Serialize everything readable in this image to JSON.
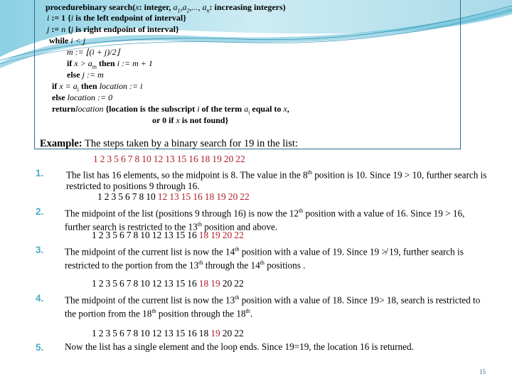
{
  "procedure": {
    "lines": [
      {
        "kw": "procedure",
        "rest": "binary search(",
        "x": "x",
        "rest2": ": integer, ",
        "a": "a",
        "subs": [
          "1",
          "2",
          "n"
        ],
        "rest3": ": increasing integers)"
      },
      {
        "text_a": "i",
        "text_b": " := 1 {",
        "text_c": "i",
        "text_d": " is the left endpoint of interval}"
      },
      {
        "text_a": "j",
        "text_b": " := ",
        "text_c": "n",
        "text_d": " {",
        "text_e": "j",
        "text_f": " is right endpoint of interval}"
      },
      {
        "kw": "while",
        "text": " i < j"
      },
      {
        "text": "m := ⌊(i + j)/2⌋"
      },
      {
        "kw1": "if",
        "t1": " x > a",
        "sub": "m",
        "kw2": " then",
        "t2": " i := m + 1"
      },
      {
        "kw": "else",
        "text": " j := m"
      },
      {
        "kw1": "if",
        "t1": " x = a",
        "sub": "i",
        "kw2": " then",
        "t2": " location := i"
      },
      {
        "kw": "else",
        "text": " location := 0"
      },
      {
        "kw": "return",
        "t1": "location",
        "t2": " {location is the subscript ",
        "t3": "i",
        "t4": " of the term ",
        "t5": "a",
        "sub": "i",
        "t6": "  equal to ",
        "t7": "x",
        "t8": ","
      },
      {
        "t1": "or 0 if ",
        "t2": "x",
        "t3": " is not found}"
      }
    ]
  },
  "example": {
    "label": "Example:",
    "text": " The steps taken by a binary search for 19 in the list:"
  },
  "lists": [
    {
      "values": [
        "1",
        "2",
        "3",
        "5",
        "6",
        "7",
        "8",
        "10",
        "12",
        "13",
        "15",
        "16",
        "18",
        "19",
        "20",
        "22"
      ],
      "highlight_from": 0,
      "highlight_to": 15
    },
    {
      "values": [
        "1",
        "2",
        "3",
        "5",
        "6",
        "7",
        "8",
        "10",
        "12",
        "13",
        "15",
        "16",
        "18",
        "19",
        "20",
        "22"
      ],
      "highlight_from": 8,
      "highlight_to": 15
    },
    {
      "values": [
        "1",
        "2",
        "3",
        "5",
        "6",
        "7",
        "8",
        "10",
        "12",
        "13",
        "15",
        "16",
        "18",
        "19",
        "20",
        "22"
      ],
      "highlight_from": 12,
      "highlight_to": 15
    },
    {
      "values": [
        "1",
        "2",
        "3",
        "5",
        "6",
        "7",
        "8",
        "10",
        "12",
        "13",
        "15",
        "16",
        "18",
        "19",
        "20",
        "22"
      ],
      "highlight_from": 12,
      "highlight_to": 13
    },
    {
      "values": [
        "1",
        "2",
        "3",
        "5",
        "6",
        "7",
        "8",
        "10",
        "12",
        "13",
        "15",
        "16",
        "18",
        "19",
        "20",
        "22"
      ],
      "highlight_from": 13,
      "highlight_to": 13
    }
  ],
  "steps": [
    {
      "num": "1.",
      "parts": [
        "The list has 16 elements, so the midpoint is 8. The value in the 8",
        "th",
        " position is 10.  Since 19 > 10,  further search is restricted to  positions 9 through 16."
      ]
    },
    {
      "num": "2.",
      "parts": [
        "The midpoint of the list (positions 9 through 16)  is now  the 12",
        "th",
        " position with a value of  16.   Since 19 > 16,  further search is restricted to the 13",
        "th",
        " position and above."
      ]
    },
    {
      "num": "3.",
      "parts": [
        "The midpoint  of the current list is now the 14",
        "th",
        " position with a value of 19.  Since 19 ≯ 19,  further search is restricted to the portion from  the 13",
        "th",
        " through the 14",
        "th",
        " positions ."
      ]
    },
    {
      "num": "4.",
      "parts": [
        "The midpoint of the current list  is now the 13",
        "th",
        " position with a value of 18. Since 19> 18, search is restricted to the  portion from the 18",
        "th",
        " position through the 18",
        "th",
        "."
      ]
    },
    {
      "num": "5.",
      "parts": [
        "Now the list has a single element and the loop ends. Since 19=19, the location 16 is returned."
      ]
    }
  ],
  "page_number": "15",
  "colors": {
    "highlight": "#b0202a",
    "step_number": "#4bacc6",
    "box_border": "#2e6b8a"
  }
}
